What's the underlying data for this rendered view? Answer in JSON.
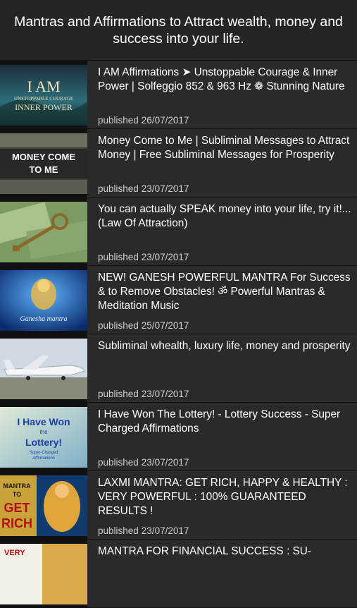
{
  "header": {
    "title": "Mantras and Affirmations to Attract wealth, money and success into your life."
  },
  "published_label": "published",
  "items": [
    {
      "title": "I AM Affirmations ➤ Unstoppable Courage & Inner Power | Solfeggio 852 & 963 Hz ❁ Stunning Nature",
      "date": "26/07/2017",
      "thumb_text": [
        "I AM",
        "UNSTOPPABLE COURAGE",
        "INNER POWER"
      ]
    },
    {
      "title": "Money Come to Me | Subliminal Messages to Attract Money | Free Subliminal Messages for Prosperity",
      "date": "23/07/2017",
      "thumb_text": [
        "MONEY COME",
        "TO ME"
      ]
    },
    {
      "title": "You can actually SPEAK money into your life, try it!...(Law Of Attraction)",
      "date": "23/07/2017",
      "thumb_text": []
    },
    {
      "title": "NEW! GANESH POWERFUL MANTRA For Success & to Remove Obstacles! ॐ Powerful Mantras & Meditation Music",
      "date": "25/07/2017",
      "thumb_text": [
        "Ganesha mantra"
      ]
    },
    {
      "title": "Subliminal whealth, luxury life, money and prosperity",
      "date": "23/07/2017",
      "thumb_text": []
    },
    {
      "title": "I Have Won The Lottery! - Lottery Success - Super Charged Affirmations",
      "date": "23/07/2017",
      "thumb_text": [
        "I Have Won",
        "the",
        "Lottery!",
        "Super-Charged",
        "Affirmations"
      ]
    },
    {
      "title": "LAXMI MANTRA: GET RICH, HAPPY & HEALTHY : VERY POWERFUL : 100% GUARANTEED RESULTS !",
      "date": "23/07/2017",
      "thumb_text": [
        "MANTRA",
        "TO",
        "GET",
        "RICH"
      ]
    },
    {
      "title": "MANTRA FOR FINANCIAL SUCCESS : SU-",
      "date": "",
      "thumb_text": [
        "VERY"
      ]
    }
  ]
}
